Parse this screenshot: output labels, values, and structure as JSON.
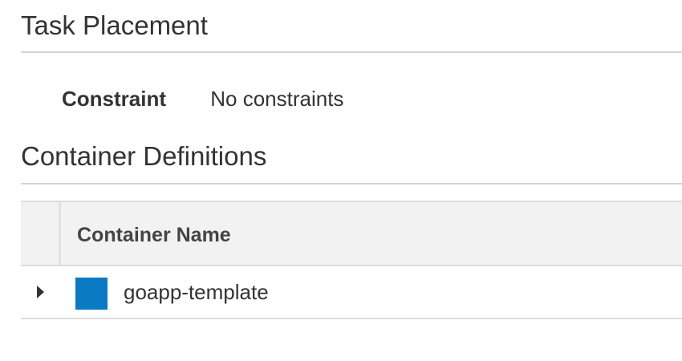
{
  "task_placement": {
    "title": "Task Placement",
    "constraint_label": "Constraint",
    "constraint_value": "No constraints"
  },
  "container_definitions": {
    "title": "Container Definitions",
    "columns": [
      "Container Name"
    ],
    "rows": [
      {
        "name": "goapp-template",
        "swatch_color": "#0a7ac4",
        "expand_icon": "caret-right-icon"
      }
    ]
  }
}
